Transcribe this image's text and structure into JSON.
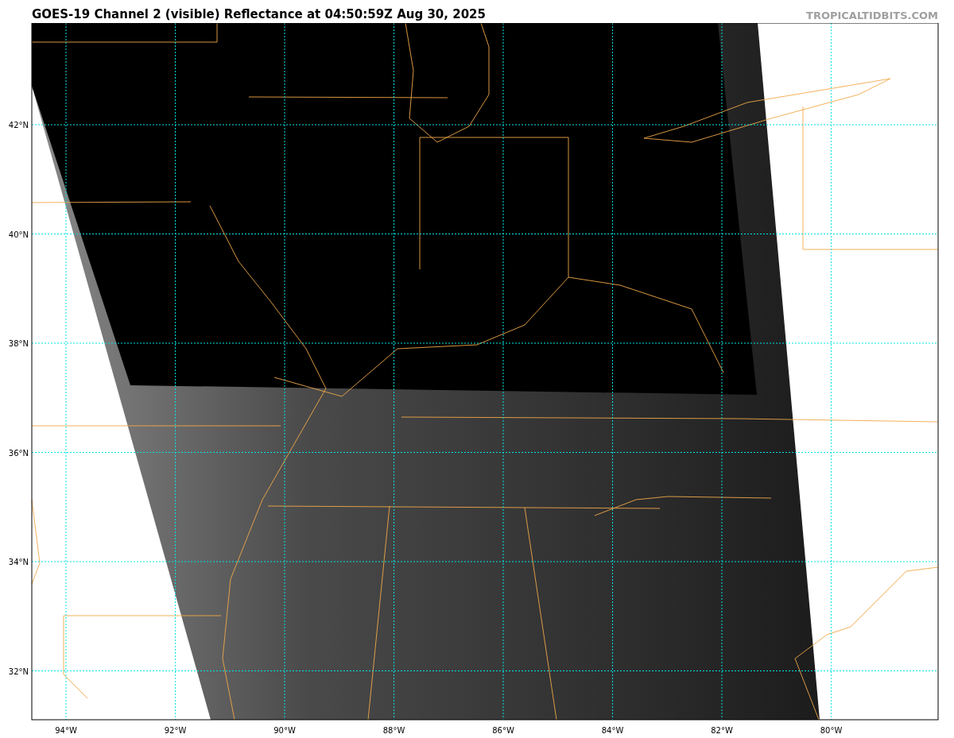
{
  "title": "GOES-19 Channel 2 (visible) Reflectance at 04:50:59Z Aug 30, 2025",
  "credit": "TROPICALTIDBITS.COM",
  "map": {
    "lat_labels": [
      "42°N",
      "40°N",
      "38°N",
      "36°N",
      "34°N",
      "32°N"
    ],
    "lon_labels": [
      "94°W",
      "92°W",
      "90°W",
      "88°W",
      "86°W",
      "84°W",
      "82°W",
      "80°W"
    ]
  }
}
